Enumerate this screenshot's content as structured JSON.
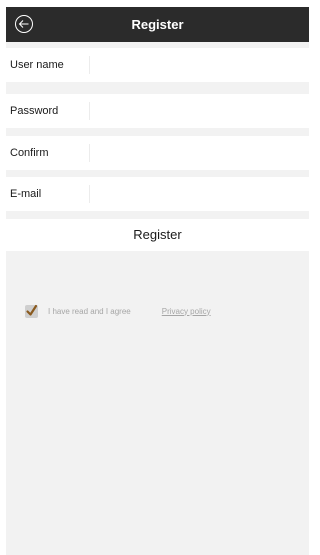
{
  "header": {
    "title": "Register",
    "back_icon": "circle-back-arrow-icon"
  },
  "form": {
    "fields": [
      {
        "label": "User name",
        "value": "",
        "placeholder": ""
      },
      {
        "label": "Password",
        "value": "",
        "placeholder": ""
      },
      {
        "label": "Confirm",
        "value": "",
        "placeholder": ""
      },
      {
        "label": "E-mail",
        "value": "",
        "placeholder": ""
      }
    ],
    "submit_label": "Register"
  },
  "agreement": {
    "checked": true,
    "text": "I have read and I agree",
    "link_label": "Privacy policy",
    "check_icon": "checkmark-icon"
  },
  "colors": {
    "topbar": "#2b2b2b",
    "background": "#f2f2f2",
    "field": "#ffffff",
    "muted_text": "#a6a6a6",
    "checkmark": "#8a5a1e"
  }
}
